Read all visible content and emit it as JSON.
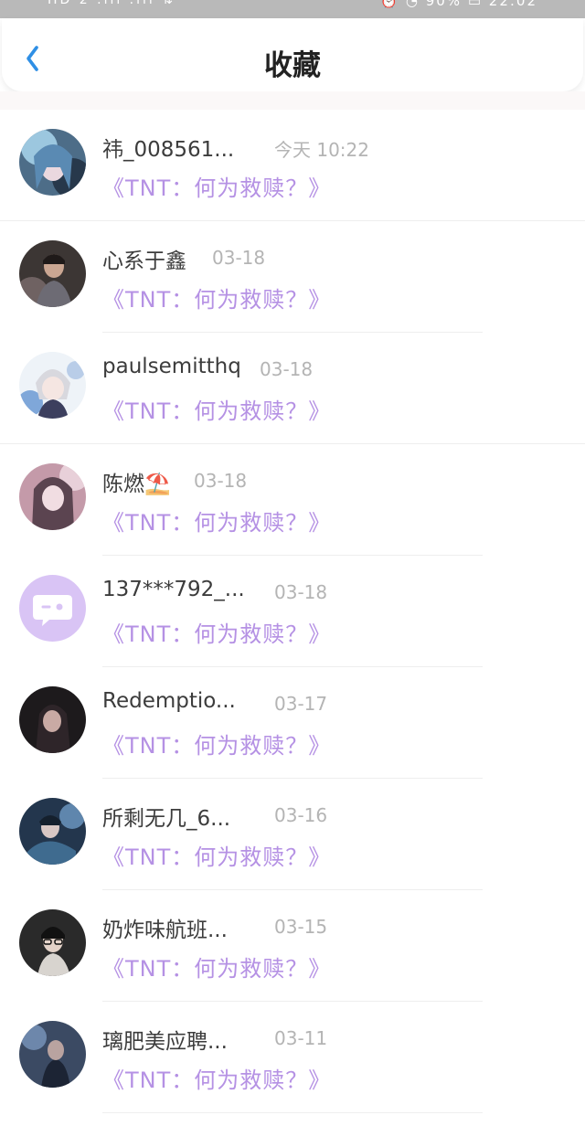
{
  "status_bar": {
    "left": "HD 2 .ııl .ııl ⇅",
    "right": "⏰ ◔ 90% ▭ 22:02"
  },
  "header": {
    "title": "收藏"
  },
  "colors": {
    "accent_blue": "#2f8fe5",
    "link_purple": "#b591e4",
    "avatar_purple": "#d9c4f5"
  },
  "items": [
    {
      "name": "祎_008561...",
      "time": "今天 10:22",
      "title": "《TNT：何为救赎？》",
      "avatar": "anime-blue-hair"
    },
    {
      "name": "心系于鑫",
      "time": "03-18",
      "title": "《TNT：何为救赎？》",
      "avatar": "photo-person-dark"
    },
    {
      "name": "paulsemitthq",
      "time": "03-18",
      "title": "《TNT：何为救赎？》",
      "avatar": "anime-white-hair"
    },
    {
      "name": "陈燃⛱️",
      "time": "03-18",
      "title": "《TNT：何为救赎？》",
      "avatar": "anime-pink-girl"
    },
    {
      "name": "137***792_...",
      "time": "03-18",
      "title": "《TNT：何为救赎？》",
      "avatar": "chat-bubble-icon"
    },
    {
      "name": "Redemptio...",
      "time": "03-17",
      "title": "《TNT：何为救赎？》",
      "avatar": "photo-girl-dark"
    },
    {
      "name": "所剩无几_6...",
      "time": "03-16",
      "title": "《TNT：何为救赎？》",
      "avatar": "anime-dark-blue"
    },
    {
      "name": "奶炸味航班...",
      "time": "03-15",
      "title": "《TNT：何为救赎？》",
      "avatar": "photo-person-glasses"
    },
    {
      "name": "璃肥美应聘...",
      "time": "03-11",
      "title": "《TNT：何为救赎？》",
      "avatar": "photo-dark-blue"
    }
  ]
}
